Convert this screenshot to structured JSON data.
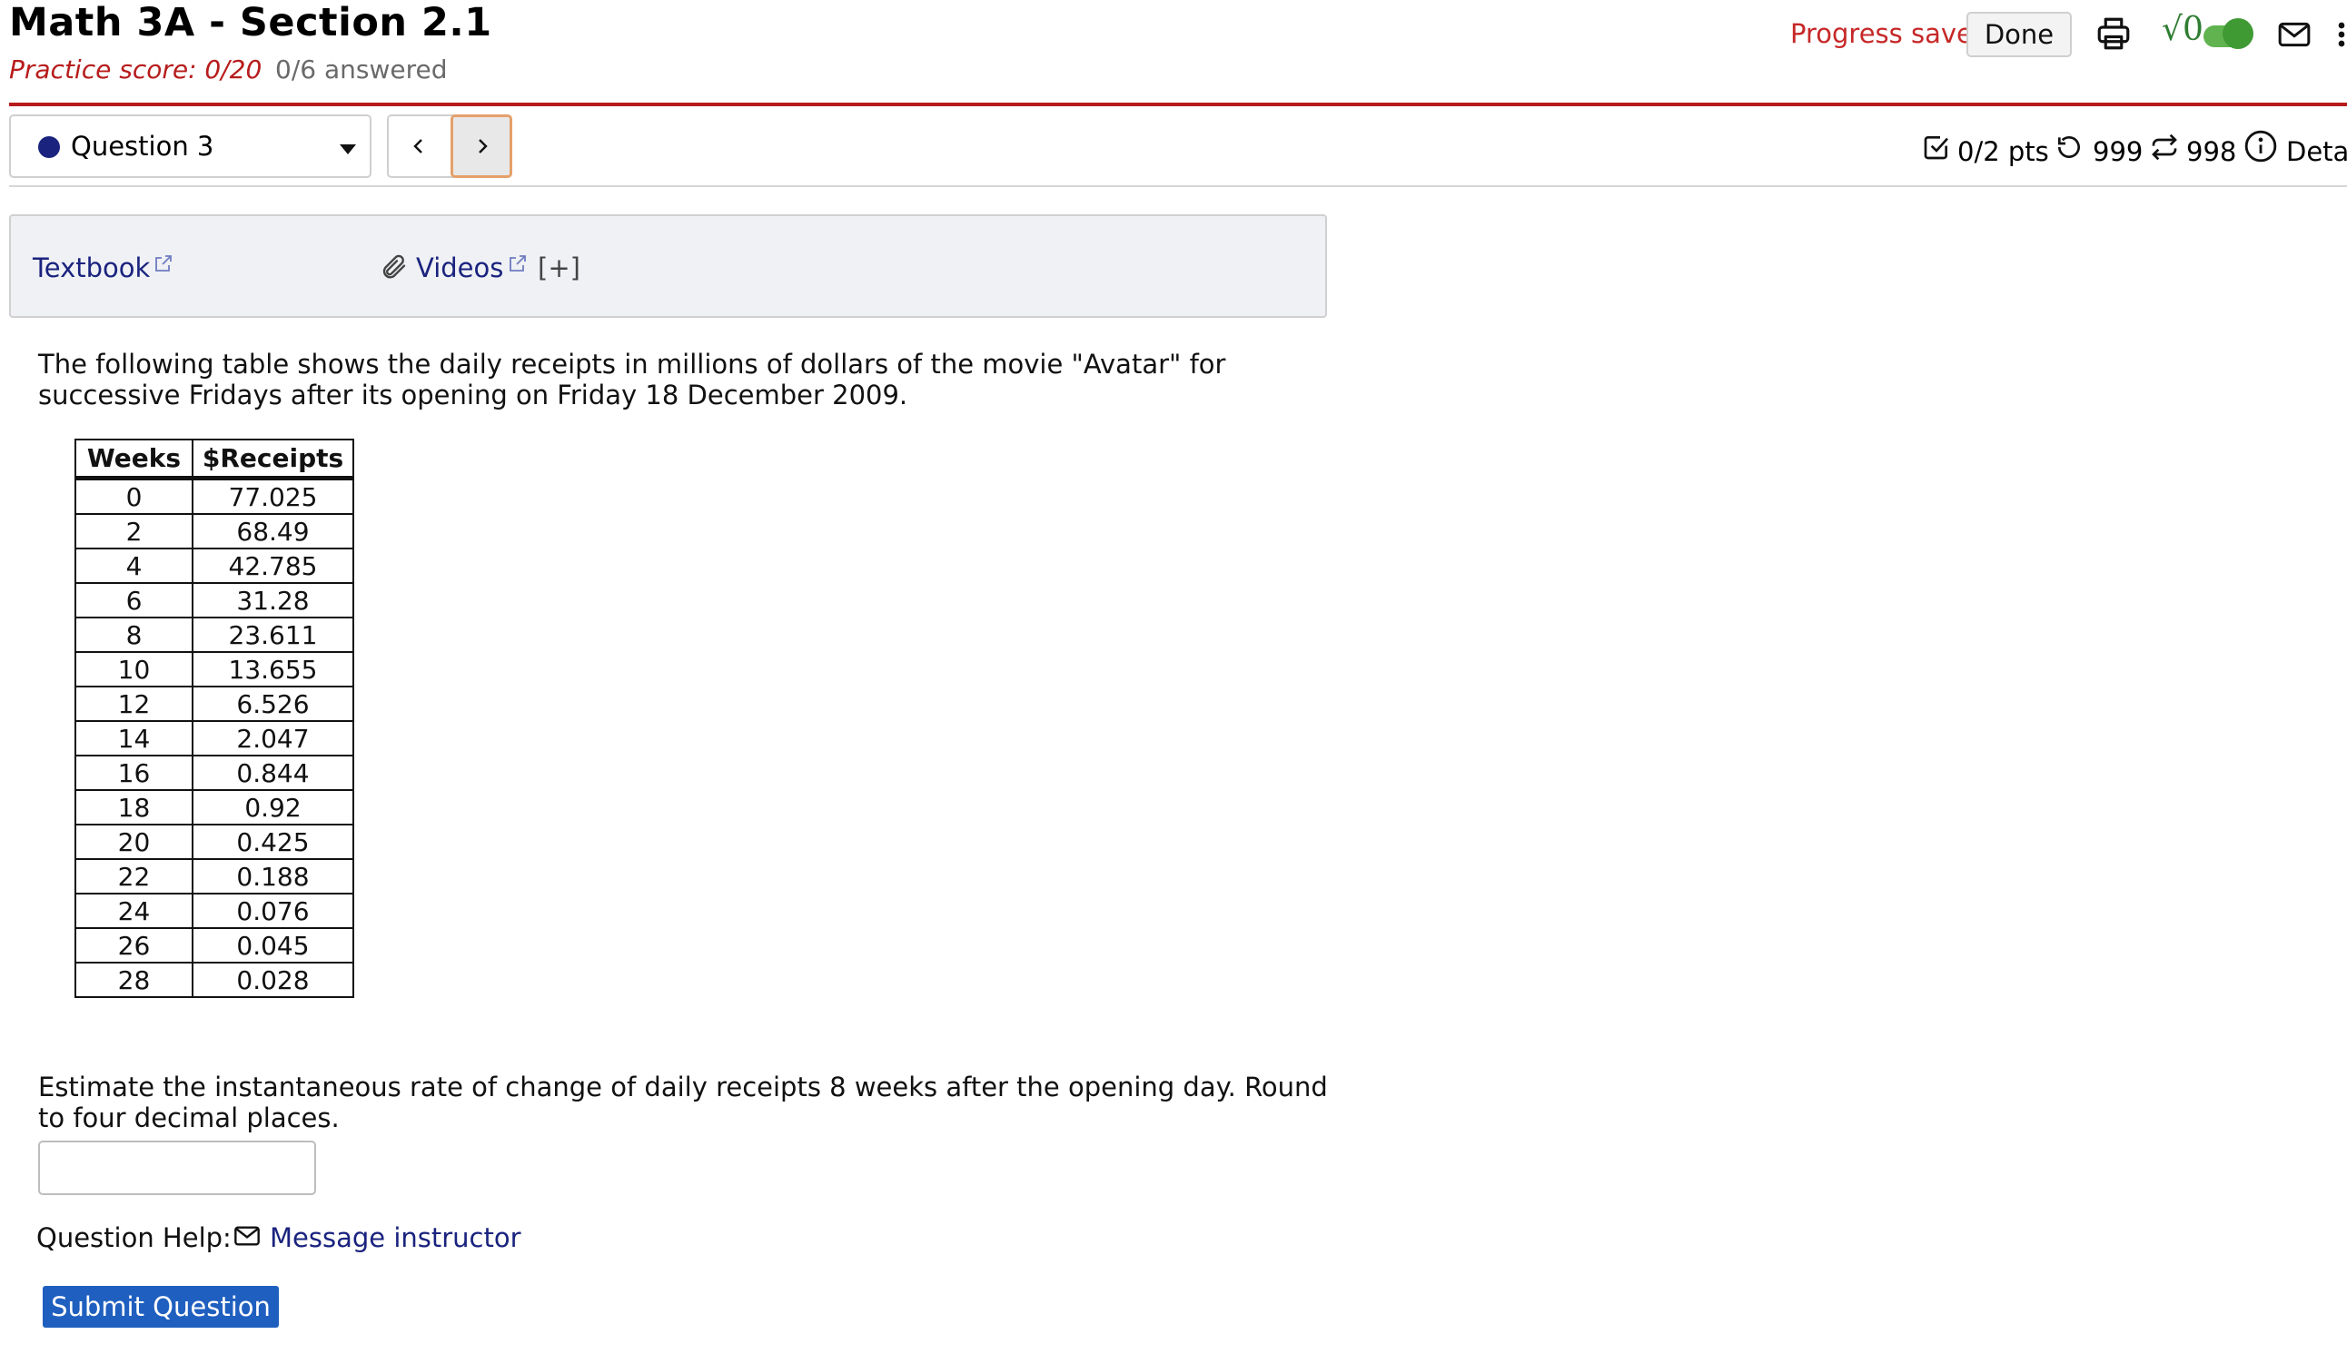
{
  "header": {
    "title": "Math 3A - Section 2.1",
    "practice_score": "Practice score: 0/20",
    "answered": "0/6 answered",
    "progress_status": "Progress saved",
    "done_label": "Done",
    "sqrt_label": "√0"
  },
  "question_nav": {
    "selected_question": "Question 3",
    "points": "0/2 pts",
    "attempts": "999",
    "regens": "998",
    "details_label": "Details"
  },
  "resources": {
    "textbook_label": "Textbook",
    "videos_label": "Videos",
    "expand_label": "[+]"
  },
  "question": {
    "intro": "The following table shows the daily receipts in millions of dollars of the movie \"Avatar\" for successive Fridays after its opening on Friday 18 December 2009.",
    "table": {
      "headers": [
        "Weeks",
        "$Receipts"
      ],
      "rows": [
        [
          "0",
          "77.025"
        ],
        [
          "2",
          "68.49"
        ],
        [
          "4",
          "42.785"
        ],
        [
          "6",
          "31.28"
        ],
        [
          "8",
          "23.611"
        ],
        [
          "10",
          "13.655"
        ],
        [
          "12",
          "6.526"
        ],
        [
          "14",
          "2.047"
        ],
        [
          "16",
          "0.844"
        ],
        [
          "18",
          "0.92"
        ],
        [
          "20",
          "0.425"
        ],
        [
          "22",
          "0.188"
        ],
        [
          "24",
          "0.076"
        ],
        [
          "26",
          "0.045"
        ],
        [
          "28",
          "0.028"
        ]
      ]
    },
    "prompt": "Estimate the instantaneous rate of change of daily receipts 8 weeks after the opening day. Round to four decimal places.",
    "answer_value": "",
    "help_label": "Question Help:",
    "message_instructor": "Message instructor",
    "submit_label": "Submit Question"
  },
  "colors": {
    "accent_red": "#b71c1c",
    "link_blue": "#1a237e",
    "submit_blue": "#1f5fbf",
    "toggle_green": "#3f9a34",
    "focus_orange": "#e5a06a"
  },
  "icons": [
    "print-icon",
    "sqrt-icon",
    "toggle-switch",
    "mail-icon",
    "more-vertical-icon",
    "checkbox-icon",
    "retry-icon",
    "regen-icon",
    "info-icon",
    "external-link-icon",
    "paperclip-icon",
    "chevron-left-icon",
    "chevron-right-icon",
    "caret-down-icon"
  ]
}
